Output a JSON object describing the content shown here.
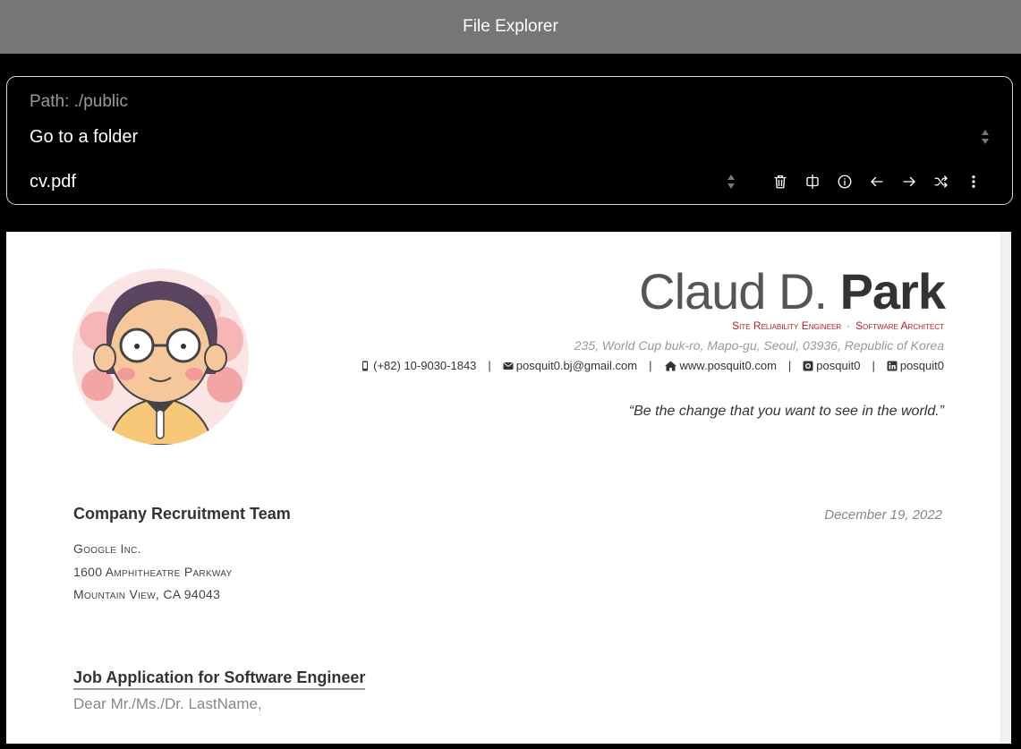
{
  "window": {
    "title": "File Explorer"
  },
  "explorer": {
    "path": "Path: ./public",
    "folder_select": "Go to a folder",
    "file_select": "cv.pdf",
    "toolbar": [
      {
        "icon": "trash-icon"
      },
      {
        "icon": "split-view-icon"
      },
      {
        "icon": "info-icon"
      },
      {
        "icon": "arrow-left-icon"
      },
      {
        "icon": "arrow-right-icon"
      },
      {
        "icon": "shuffle-icon"
      },
      {
        "icon": "more-vertical-icon"
      }
    ]
  },
  "document": {
    "name_light": "Claud D. ",
    "name_bold": "Park",
    "role_1": "Site Reliability Engineer",
    "role_sep": "·",
    "role_2": "Software Architect",
    "address": "235, World Cup buk-ro, Mapo-gu, Seoul, 03936, Republic of Korea",
    "contacts": {
      "phone": "(+82) 10-9030-1843",
      "email": "posquit0.bj@gmail.com",
      "website": "www.posquit0.com",
      "github": "posquit0",
      "linkedin": "posquit0",
      "separator": "|"
    },
    "quote": "“Be the change that you want to see in the world.”",
    "recipient": "Company Recruitment Team",
    "date": "December 19, 2022",
    "recipient_address": [
      "Google Inc.",
      "1600 Amphitheatre Parkway",
      "Mountain View, CA 94043"
    ],
    "subject": "Job Application for Software Engineer",
    "greeting": "Dear Mr./Ms./Dr. LastName,"
  },
  "colors": {
    "titlebar": "#767676",
    "accent_role": "#b22222",
    "background": "#000000"
  }
}
